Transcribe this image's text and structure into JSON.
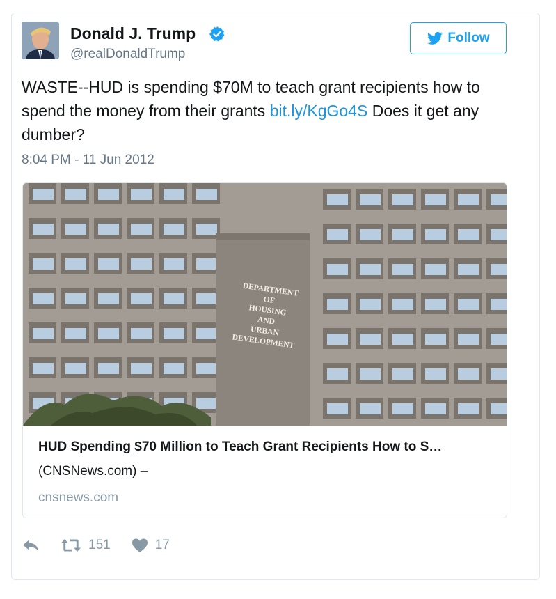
{
  "tweet": {
    "display_name": "Donald J. Trump",
    "handle": "@realDonaldTrump",
    "follow_label": "Follow",
    "text_before": "WASTE--HUD is spending $70M to teach grant recipients how to spend the money from their grants ",
    "link_text": "bit.ly/KgGo4S",
    "text_after": " Does it get any dumber?",
    "timestamp": "8:04 PM - 11 Jun 2012"
  },
  "card": {
    "sign_lines": [
      "DEPARTMENT",
      "OF",
      "HOUSING",
      "AND",
      "URBAN",
      "DEVELOPMENT"
    ],
    "title": "HUD Spending $70 Million to Teach Grant Recipients How to S…",
    "description": "(CNSNews.com) –",
    "domain": "cnsnews.com"
  },
  "actions": {
    "retweet_count": "151",
    "like_count": "17"
  },
  "colors": {
    "accent": "#1da1f2",
    "link": "#1b95e0",
    "muted": "#657786",
    "border": "#e1e8ed"
  },
  "icons": [
    "verified-badge-icon",
    "twitter-bird-icon",
    "reply-icon",
    "retweet-icon",
    "heart-icon"
  ]
}
